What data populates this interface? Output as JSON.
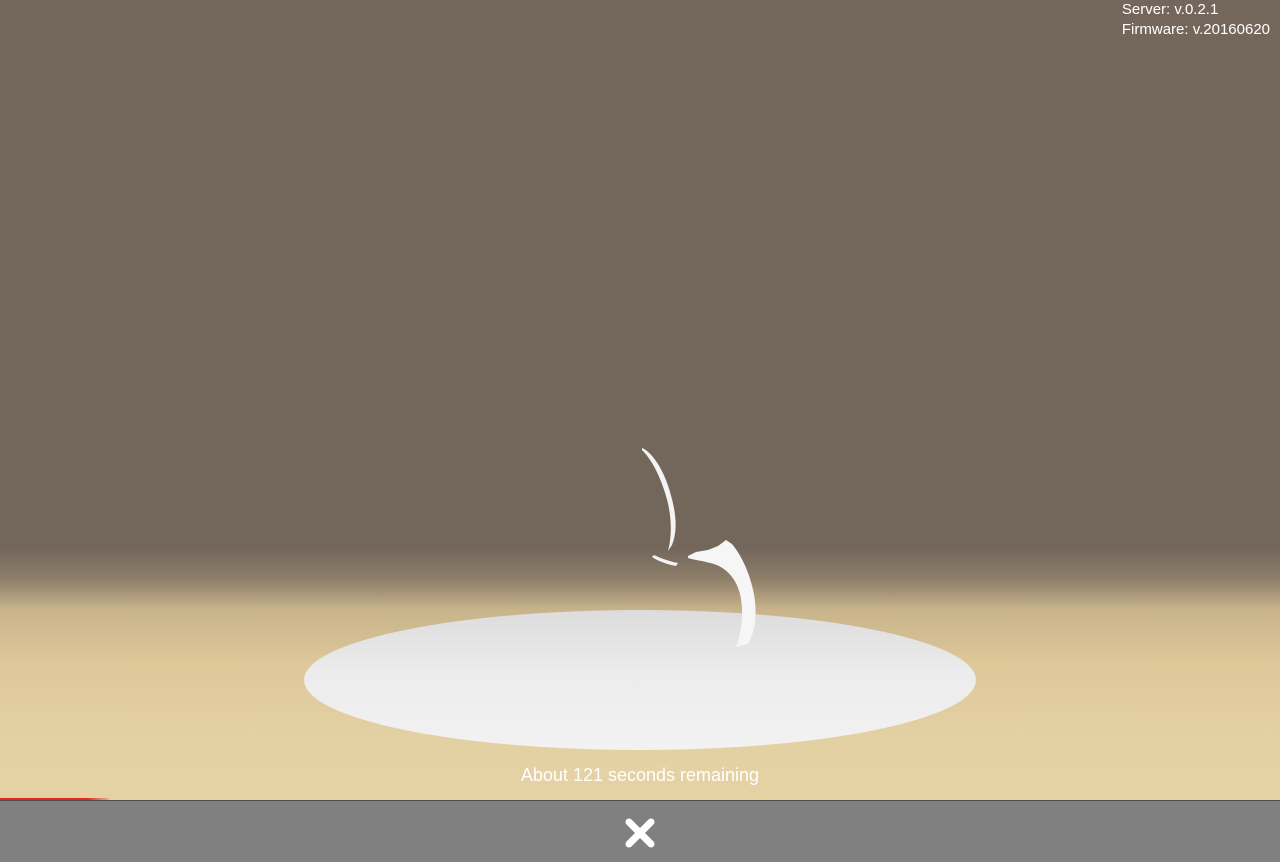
{
  "versions": {
    "server": "Server: v.0.2.1",
    "firmware": "Firmware: v.20160620"
  },
  "status": {
    "message": "About 121 seconds remaining",
    "progress_fraction": 0.085
  },
  "toolbar": {
    "close_icon": "close-icon"
  },
  "colors": {
    "background_top": "#73665b",
    "floor": "#e5d2a4",
    "platform": "#eeeeee",
    "progress": "#e5281e",
    "toolbar": "#808080"
  }
}
